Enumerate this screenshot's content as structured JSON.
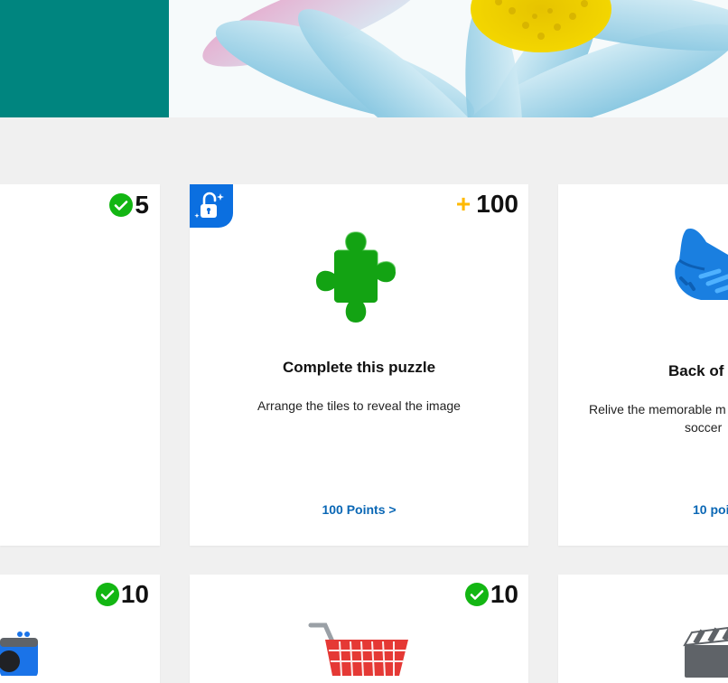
{
  "cards": {
    "left": {
      "badge_value": "5"
    },
    "puzzle": {
      "badge_value": "100",
      "badge_prefix": "+",
      "title": "Complete this puzzle",
      "description": "Arrange the tiles to reveal the image",
      "link": "100 Points >"
    },
    "soccer": {
      "title": "Back of",
      "description_line1": "Relive the memorable m",
      "description_line2": "soccer",
      "link": "10 poi"
    },
    "bottom_left": {
      "badge_value": "10"
    },
    "bottom_middle": {
      "badge_value": "10"
    }
  },
  "icons": {
    "hero": "daisy-flower-image",
    "lock": "unlock-icon",
    "puzzle": "puzzle-piece-icon",
    "shoe": "soccer-cleat-icon",
    "camera": "camera-icon",
    "cart": "shopping-cart-icon",
    "clapper": "clapperboard-icon",
    "check": "checkmark-icon"
  },
  "colors": {
    "teal": "#00857f",
    "green": "#13b613",
    "blue_link": "#0a67b5",
    "gold": "#ffb900",
    "puzzle_green": "#13a313",
    "lock_blue": "#0b6fe0"
  }
}
